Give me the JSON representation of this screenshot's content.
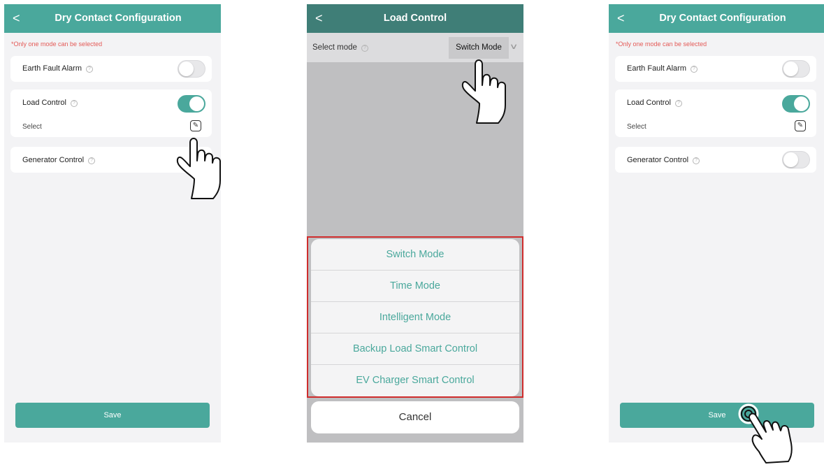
{
  "screen1": {
    "back_glyph": "<",
    "title": "Dry Contact Configuration",
    "warning": "*Only one mode can be selected",
    "earth_fault_label": "Earth Fault Alarm",
    "earth_fault_on": false,
    "load_control_label": "Load Control",
    "load_control_on": true,
    "select_label": "Select",
    "generator_label": "Generator Control",
    "save_label": "Save"
  },
  "screen2": {
    "back_glyph": "<",
    "title": "Load Control",
    "select_mode_label": "Select mode",
    "selected_mode": "Switch Mode",
    "options": [
      "Switch Mode",
      "Time Mode",
      "Intelligent Mode",
      "Backup Load Smart Control",
      "EV Charger Smart Control"
    ],
    "cancel_label": "Cancel"
  },
  "screen3": {
    "back_glyph": "<",
    "title": "Dry Contact Configuration",
    "warning": "*Only one mode can be selected",
    "earth_fault_label": "Earth Fault Alarm",
    "earth_fault_on": false,
    "load_control_label": "Load Control",
    "load_control_on": true,
    "select_label": "Select",
    "generator_label": "Generator Control",
    "generator_on": false,
    "save_label": "Save"
  },
  "colors": {
    "accent": "#4aa89c",
    "header_dimmed": "#3f7e77",
    "warning": "#e45a57",
    "highlight_frame": "#cf2c2c"
  },
  "icons": [
    "back-chevron-icon",
    "help-circle-icon",
    "edit-pencil-icon",
    "dropdown-chevron-icon",
    "pointing-hand-icon",
    "tapping-hand-icon"
  ]
}
